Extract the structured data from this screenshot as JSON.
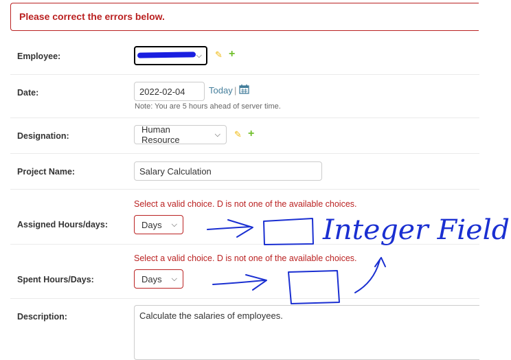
{
  "error_banner": "Please correct the errors below.",
  "fields": {
    "employee": {
      "label": "Employee:",
      "value": ""
    },
    "date": {
      "label": "Date:",
      "value": "2022-02-04",
      "today": "Today",
      "separator": "|",
      "note": "Note: You are 5 hours ahead of server time."
    },
    "designation": {
      "label": "Designation:",
      "value": "Human Resource"
    },
    "project_name": {
      "label": "Project Name:",
      "value": "Salary Calculation"
    },
    "assigned_hours": {
      "label": "Assigned Hours/days:",
      "value": "Days",
      "error": "Select a valid choice. D is not one of the available choices."
    },
    "spent_hours": {
      "label": "Spent Hours/Days:",
      "value": "Days",
      "error": "Select a valid choice. D is not one of the available choices."
    },
    "description": {
      "label": "Description:",
      "value": "Calculate the salaries of employees."
    }
  },
  "annotation": {
    "text": "Integer Field"
  },
  "colors": {
    "error": "#ba2121",
    "link": "#447e9b",
    "ink": "#1a2fd1",
    "edit": "#efb80b",
    "add": "#70bf2b"
  },
  "icons": {
    "edit": "pencil-icon",
    "add": "plus-icon",
    "calendar": "calendar-icon",
    "chevron": "chevron-down-icon"
  }
}
